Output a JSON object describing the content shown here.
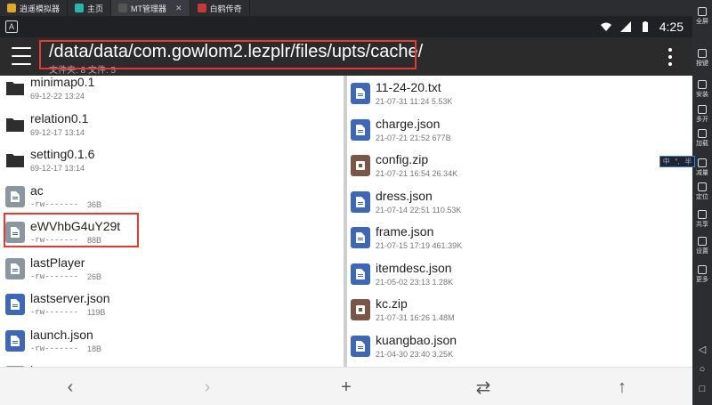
{
  "tabs": [
    {
      "label": "逍遥模拟器",
      "color": "#e1a62c",
      "active": false
    },
    {
      "label": "主页",
      "color": "#2bb5b0",
      "active": false
    },
    {
      "label": "MT管理器",
      "color": "#3c3c3c",
      "active": true
    },
    {
      "label": "白鹤传奇",
      "color": "#c43a3a",
      "active": false
    }
  ],
  "status": {
    "badge": "A",
    "time": "4:25"
  },
  "appbar": {
    "path": "/data/data/com.gowlom2.lezplr/files/upts/cache/",
    "summary": "文件夹: 8  文件: 5"
  },
  "left_files": [
    {
      "name": "minimap0.1",
      "meta": "69-12-22 13:24",
      "type": "folder"
    },
    {
      "name": "relation0.1",
      "meta": "69-12-17 13:14",
      "type": "folder"
    },
    {
      "name": "setting0.1.6",
      "meta": "69-12-17 13:14",
      "type": "folder"
    },
    {
      "name": "ac",
      "perm": "-rw-------",
      "size": "36B",
      "type": "gray"
    },
    {
      "name": "eWVhbG4uY29t",
      "perm": "-rw-------",
      "size": "88B",
      "type": "gray"
    },
    {
      "name": "lastPlayer",
      "perm": "-rw-------",
      "size": "26B",
      "type": "gray"
    },
    {
      "name": "lastserver.json",
      "perm": "-rw-------",
      "size": "119B",
      "type": "doc"
    },
    {
      "name": "launch.json",
      "perm": "-rw-------",
      "size": "18B",
      "type": "doc"
    },
    {
      "name": "lg",
      "perm": "",
      "size": "",
      "type": "gray"
    }
  ],
  "right_files": [
    {
      "name": "11-24-20.txt",
      "meta": "21-07-31 11:24  5.53K",
      "type": "doc"
    },
    {
      "name": "charge.json",
      "meta": "21-07-21 21:52  677B",
      "type": "doc"
    },
    {
      "name": "config.zip",
      "meta": "21-07-21 16:54  26.34K",
      "type": "zip"
    },
    {
      "name": "dress.json",
      "meta": "21-07-14 22:51  110.53K",
      "type": "doc"
    },
    {
      "name": "frame.json",
      "meta": "21-07-15 17:19  461.39K",
      "type": "doc"
    },
    {
      "name": "itemdesc.json",
      "meta": "21-05-02 23:13  1.28K",
      "type": "doc"
    },
    {
      "name": "kc.zip",
      "meta": "21-07-31 16:26  1.48M",
      "type": "zip"
    },
    {
      "name": "kuangbao.json",
      "meta": "21-04-30 23:40  3.25K",
      "type": "doc"
    }
  ],
  "sidebar": [
    {
      "label": "全屏"
    },
    {
      "label": "按键"
    },
    {
      "label": "安装"
    },
    {
      "label": "多开"
    },
    {
      "label": "加载"
    },
    {
      "label": "减量"
    },
    {
      "label": "定位"
    },
    {
      "label": "共享"
    },
    {
      "label": "设置"
    },
    {
      "label": "更多"
    }
  ],
  "ime": {
    "a": "中",
    "b": "°,",
    "c": "半"
  },
  "icons": {
    "menu": "hamburger-menu-icon",
    "more": "overflow-menu-icon",
    "back": "chevron-left-icon",
    "forward": "chevron-right-icon",
    "add": "plus-icon",
    "swap": "swap-arrows-icon",
    "up": "arrow-up-icon"
  }
}
